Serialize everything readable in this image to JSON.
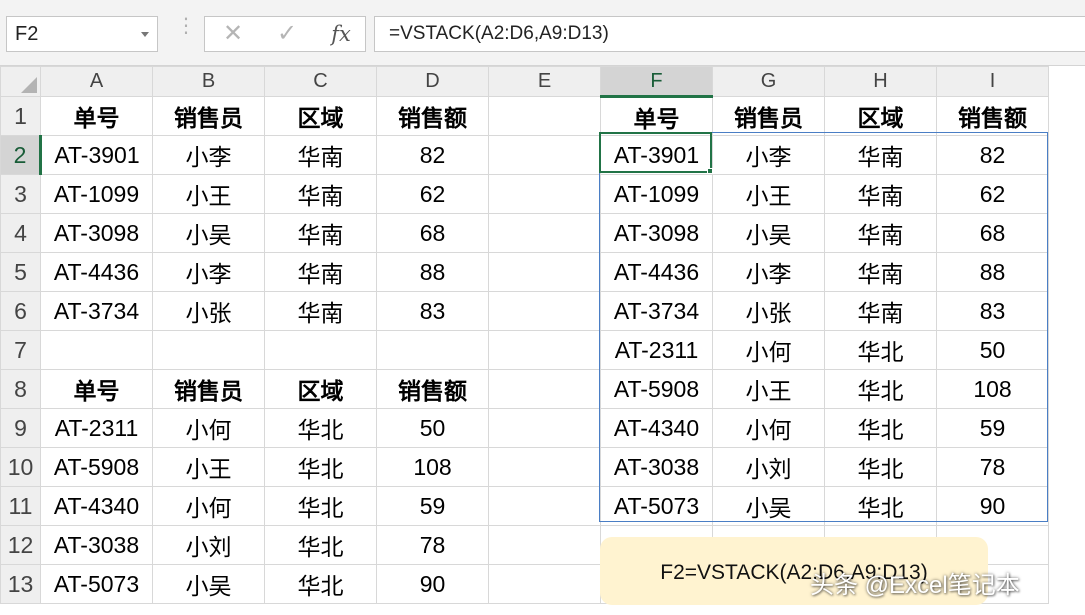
{
  "formula_bar": {
    "name_box": "F2",
    "cancel_icon": "cancel-x-icon",
    "enter_icon": "checkmark-icon",
    "fx_label": "fx",
    "formula": "=VSTACK(A2:D6,A9:D13)"
  },
  "columns": [
    "A",
    "B",
    "C",
    "D",
    "E",
    "F",
    "G",
    "H",
    "I"
  ],
  "selected_column": "F",
  "selected_row": 2,
  "rows": [
    {
      "num": "1",
      "cells": [
        "单号",
        "销售员",
        "区域",
        "销售额",
        "",
        "单号",
        "销售员",
        "区域",
        "销售额"
      ]
    },
    {
      "num": "2",
      "cells": [
        "AT-3901",
        "小李",
        "华南",
        "82",
        "",
        "AT-3901",
        "小李",
        "华南",
        "82"
      ]
    },
    {
      "num": "3",
      "cells": [
        "AT-1099",
        "小王",
        "华南",
        "62",
        "",
        "AT-1099",
        "小王",
        "华南",
        "62"
      ]
    },
    {
      "num": "4",
      "cells": [
        "AT-3098",
        "小吴",
        "华南",
        "68",
        "",
        "AT-3098",
        "小吴",
        "华南",
        "68"
      ]
    },
    {
      "num": "5",
      "cells": [
        "AT-4436",
        "小李",
        "华南",
        "88",
        "",
        "AT-4436",
        "小李",
        "华南",
        "88"
      ]
    },
    {
      "num": "6",
      "cells": [
        "AT-3734",
        "小张",
        "华南",
        "83",
        "",
        "AT-3734",
        "小张",
        "华南",
        "83"
      ]
    },
    {
      "num": "7",
      "cells": [
        "",
        "",
        "",
        "",
        "",
        "AT-2311",
        "小何",
        "华北",
        "50"
      ]
    },
    {
      "num": "8",
      "cells": [
        "单号",
        "销售员",
        "区域",
        "销售额",
        "",
        "AT-5908",
        "小王",
        "华北",
        "108"
      ]
    },
    {
      "num": "9",
      "cells": [
        "AT-2311",
        "小何",
        "华北",
        "50",
        "",
        "AT-4340",
        "小何",
        "华北",
        "59"
      ]
    },
    {
      "num": "10",
      "cells": [
        "AT-5908",
        "小王",
        "华北",
        "108",
        "",
        "AT-3038",
        "小刘",
        "华北",
        "78"
      ]
    },
    {
      "num": "11",
      "cells": [
        "AT-4340",
        "小何",
        "华北",
        "59",
        "",
        "AT-5073",
        "小吴",
        "华北",
        "90"
      ]
    },
    {
      "num": "12",
      "cells": [
        "AT-3038",
        "小刘",
        "华北",
        "78",
        "",
        "",
        "",
        "",
        ""
      ]
    },
    {
      "num": "13",
      "cells": [
        "AT-5073",
        "小吴",
        "华北",
        "90",
        "",
        "",
        "",
        "",
        ""
      ]
    }
  ],
  "bold_rows": [
    "1",
    "8"
  ],
  "note": "F2=VSTACK(A2:D6,A9:D13)",
  "watermark": "头条 @Excel笔记本",
  "colors": {
    "accent": "#217346",
    "spill_border": "#4a7ec5",
    "note_bg": "#fff3d0"
  }
}
